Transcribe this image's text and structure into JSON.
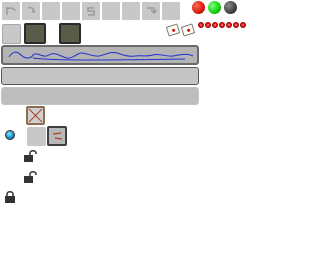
{
  "toolbar": {
    "buttons": [
      {
        "icon": "undo-icon"
      },
      {
        "icon": "redo-icon"
      },
      {
        "icon": "blank-icon"
      },
      {
        "icon": "blank-icon"
      },
      {
        "icon": "refresh-icon"
      },
      {
        "icon": "blank-icon"
      },
      {
        "icon": "blank-icon"
      },
      {
        "icon": "export-icon"
      },
      {
        "icon": "blank-icon"
      }
    ],
    "lights": [
      "#e02010",
      "#20d020",
      "#444444"
    ],
    "number_dots": [
      "1",
      "2",
      "3",
      "4",
      "5",
      "6",
      "7"
    ]
  },
  "layer_bars": [
    {
      "state": "selected",
      "stroke_color": "#2030d0"
    },
    {
      "state": "outlined"
    },
    {
      "state": "plain"
    }
  ],
  "lock_states": [
    "unlocked",
    "unlocked",
    "locked"
  ],
  "colors": {
    "accent": "#8a7050",
    "stroke": "#2030d0",
    "tool_line": "#b04020"
  }
}
